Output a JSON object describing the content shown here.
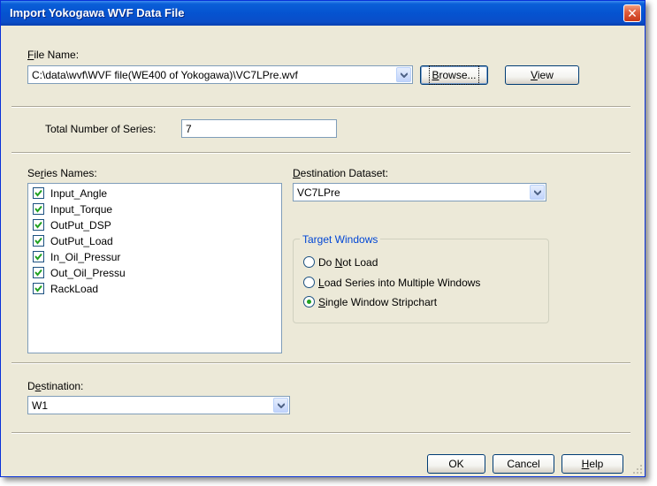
{
  "window": {
    "title": "Import Yokogawa WVF Data File",
    "close_glyph": "✕"
  },
  "file": {
    "label_key": "F",
    "label_rest": "ile Name:",
    "path": "C:\\data\\wvf\\WVF file(WE400 of Yokogawa)\\VC7LPre.wvf",
    "browse_key": "B",
    "browse_rest": "rowse...",
    "view_key": "V",
    "view_rest": "iew"
  },
  "series_count": {
    "label": "Total Number of Series:",
    "value": "7"
  },
  "series": {
    "label_pre": "Se",
    "label_key": "r",
    "label_rest": "ies Names:",
    "items": [
      {
        "name": "Input_Angle",
        "checked": true
      },
      {
        "name": "Input_Torque",
        "checked": true
      },
      {
        "name": "OutPut_DSP",
        "checked": true
      },
      {
        "name": "OutPut_Load",
        "checked": true
      },
      {
        "name": "In_Oil_Pressur",
        "checked": true
      },
      {
        "name": "Out_Oil_Pressu",
        "checked": true
      },
      {
        "name": "RackLoad",
        "checked": true
      }
    ]
  },
  "dataset": {
    "label_key": "D",
    "label_rest": "estination Dataset:",
    "value": "VC7LPre"
  },
  "target": {
    "title": "Target Windows",
    "options": [
      {
        "pre": "Do ",
        "key": "N",
        "rest": "ot Load",
        "selected": false
      },
      {
        "pre": "",
        "key": "L",
        "rest": "oad Series into Multiple Windows",
        "selected": false
      },
      {
        "pre": "",
        "key": "S",
        "rest": "ingle Window Stripchart",
        "selected": true
      }
    ]
  },
  "destination": {
    "label_pre": "D",
    "label_key": "e",
    "label_rest": "stination:",
    "value": "W1"
  },
  "buttons": {
    "ok": "OK",
    "cancel": "Cancel",
    "help_key": "H",
    "help_rest": "elp"
  }
}
